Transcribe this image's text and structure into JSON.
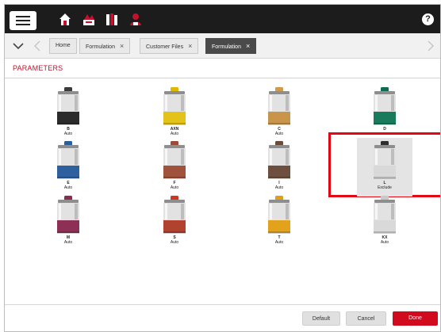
{
  "topbar": {
    "menu_icon": "hamburger-menu-icon",
    "icons": [
      "home-icon",
      "formulation-icon",
      "library-icon",
      "customer-icon"
    ],
    "help_label": "?"
  },
  "tabbar": {
    "tabs": [
      {
        "label": "Home",
        "closable": false,
        "active": false
      },
      {
        "label": "Formulation",
        "closable": true,
        "active": false
      },
      {
        "label": "Customer Files",
        "closable": true,
        "active": false
      },
      {
        "label": "Formulation",
        "closable": true,
        "active": true
      }
    ],
    "close_glyph": "×"
  },
  "parameters": {
    "title": "PARAMETERS",
    "canisters": [
      {
        "code": "B",
        "status": "Auto",
        "color": "#2b2b2b",
        "cap": "#3a3a3a"
      },
      {
        "code": "AXN",
        "status": "Auto",
        "color": "#e3c21a",
        "cap": "#e0b800"
      },
      {
        "code": "C",
        "status": "Auto",
        "color": "#c8954a",
        "cap": "#d19a4a"
      },
      {
        "code": "D",
        "status": "",
        "color": "#1a7a5c",
        "cap": "#0e6b52"
      },
      {
        "code": "E",
        "status": "Auto",
        "color": "#2e5f9e",
        "cap": "#2a5d9a"
      },
      {
        "code": "F",
        "status": "Auto",
        "color": "#a0523d",
        "cap": "#9b4c36"
      },
      {
        "code": "I",
        "status": "Auto",
        "color": "#6e4f3e",
        "cap": "#6a4b3a"
      },
      {
        "code": "L",
        "status": "Exclude",
        "color": "#d9d9d9",
        "cap": "#2e2e2e"
      },
      {
        "code": "M",
        "status": "Auto",
        "color": "#8e2f56",
        "cap": "#8a2b52"
      },
      {
        "code": "S",
        "status": "Auto",
        "color": "#b0422e",
        "cap": "#c83a24"
      },
      {
        "code": "T",
        "status": "Auto",
        "color": "#e3a21c",
        "cap": "#e0a015"
      },
      {
        "code": "KX",
        "status": "Auto",
        "color": "#d9d9d9",
        "cap": "#c9c9c9"
      }
    ]
  },
  "footer": {
    "default_label": "Default",
    "cancel_label": "Cancel",
    "done_label": "Done"
  }
}
